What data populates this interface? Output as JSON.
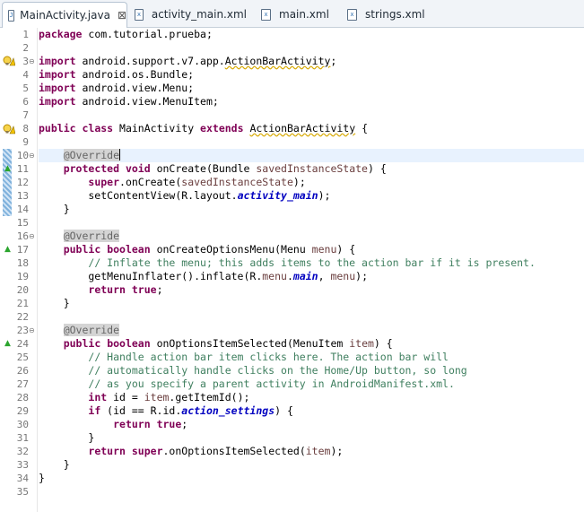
{
  "tabs": [
    {
      "label": "MainActivity.java",
      "icon": "java-file-icon",
      "active": true,
      "close": "⊠"
    },
    {
      "label": "activity_main.xml",
      "icon": "xml-file-icon",
      "active": false
    },
    {
      "label": "main.xml",
      "icon": "xml-file-icon",
      "active": false
    },
    {
      "label": "strings.xml",
      "icon": "xml-file-icon",
      "active": false
    }
  ],
  "gutter": {
    "fold_collapsed": "⊖",
    "override_marker": "▲"
  },
  "code": {
    "lines": [
      {
        "n": "1",
        "text": "package com.tutorial.prueba;"
      },
      {
        "n": "2",
        "text": ""
      },
      {
        "n": "3",
        "text": "import android.support.v7.app.ActionBarActivity;"
      },
      {
        "n": "4",
        "text": "import android.os.Bundle;"
      },
      {
        "n": "5",
        "text": "import android.view.Menu;"
      },
      {
        "n": "6",
        "text": "import android.view.MenuItem;"
      },
      {
        "n": "7",
        "text": ""
      },
      {
        "n": "8",
        "text": "public class MainActivity extends ActionBarActivity {"
      },
      {
        "n": "9",
        "text": ""
      },
      {
        "n": "10",
        "text": "    @Override"
      },
      {
        "n": "11",
        "text": "    protected void onCreate(Bundle savedInstanceState) {"
      },
      {
        "n": "12",
        "text": "        super.onCreate(savedInstanceState);"
      },
      {
        "n": "13",
        "text": "        setContentView(R.layout.activity_main);"
      },
      {
        "n": "14",
        "text": "    }"
      },
      {
        "n": "15",
        "text": ""
      },
      {
        "n": "16",
        "text": "    @Override"
      },
      {
        "n": "17",
        "text": "    public boolean onCreateOptionsMenu(Menu menu) {"
      },
      {
        "n": "18",
        "text": "        // Inflate the menu; this adds items to the action bar if it is present."
      },
      {
        "n": "19",
        "text": "        getMenuInflater().inflate(R.menu.main, menu);"
      },
      {
        "n": "20",
        "text": "        return true;"
      },
      {
        "n": "21",
        "text": "    }"
      },
      {
        "n": "22",
        "text": ""
      },
      {
        "n": "23",
        "text": "    @Override"
      },
      {
        "n": "24",
        "text": "    public boolean onOptionsItemSelected(MenuItem item) {"
      },
      {
        "n": "25",
        "text": "        // Handle action bar item clicks here. The action bar will"
      },
      {
        "n": "26",
        "text": "        // automatically handle clicks on the Home/Up button, so long"
      },
      {
        "n": "27",
        "text": "        // as you specify a parent activity in AndroidManifest.xml."
      },
      {
        "n": "28",
        "text": "        int id = item.getItemId();"
      },
      {
        "n": "29",
        "text": "        if (id == R.id.action_settings) {"
      },
      {
        "n": "30",
        "text": "            return true;"
      },
      {
        "n": "31",
        "text": "        }"
      },
      {
        "n": "32",
        "text": "        return super.onOptionsItemSelected(item);"
      },
      {
        "n": "33",
        "text": "    }"
      },
      {
        "n": "34",
        "text": "}"
      },
      {
        "n": "35",
        "text": ""
      }
    ]
  },
  "colors": {
    "keyword": "#7f0055",
    "comment": "#3f7f5f",
    "field": "#0000c0",
    "annotation_bg": "#d4d4d4",
    "current_line": "#e8f2fe"
  }
}
